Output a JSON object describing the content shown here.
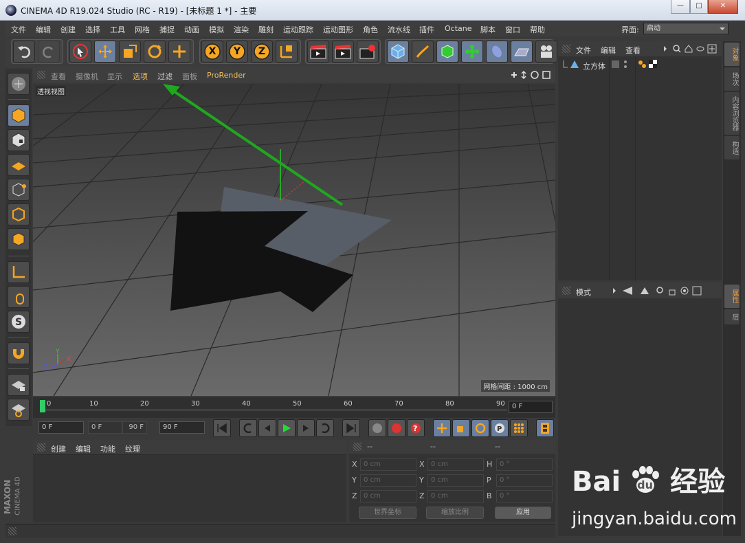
{
  "window": {
    "title": "CINEMA 4D R19.024 Studio (RC - R19) - [未标题 1 *] - 主要",
    "buttons": {
      "minimize": "—",
      "maximize": "□",
      "close": "✕"
    }
  },
  "menu": {
    "items": [
      "文件",
      "编辑",
      "创建",
      "选择",
      "工具",
      "网格",
      "捕捉",
      "动画",
      "模拟",
      "渲染",
      "雕刻",
      "运动跟踪",
      "运动图形",
      "角色",
      "流水线",
      "插件",
      "Octane",
      "脚本",
      "窗口",
      "帮助"
    ],
    "layout_label": "界面:",
    "layout_value": "启动"
  },
  "toolbar": {
    "axis_x": "X",
    "axis_y": "Y",
    "axis_z": "Z"
  },
  "viewport": {
    "menu": [
      "查看",
      "摄像机",
      "显示",
      "选项",
      "过滤",
      "面板",
      "ProRender"
    ],
    "view_name": "透视视图",
    "grid_spacing": "网格间距 : 1000 cm",
    "axis_labels": {
      "x": "X",
      "y": "Y",
      "z": "Z"
    }
  },
  "timeline": {
    "ticks": [
      "0",
      "10",
      "20",
      "30",
      "40",
      "50",
      "60",
      "70",
      "80",
      "90"
    ],
    "current_frame": "0 F"
  },
  "transport": {
    "start_field": "0 F",
    "range_start": "0 F",
    "range_end": "90 F",
    "end_field": "90 F"
  },
  "materials": {
    "menu": [
      "创建",
      "编辑",
      "功能",
      "纹理"
    ]
  },
  "coordinates": {
    "headers": [
      "--",
      "--",
      "--"
    ],
    "rows": [
      {
        "a_label": "X",
        "a_value": "0 cm",
        "b_label": "X",
        "b_value": "0 cm",
        "c_label": "H",
        "c_value": "0 °"
      },
      {
        "a_label": "Y",
        "a_value": "0 cm",
        "b_label": "Y",
        "b_value": "0 cm",
        "c_label": "P",
        "c_value": "0 °"
      },
      {
        "a_label": "Z",
        "a_value": "0 cm",
        "b_label": "Z",
        "b_value": "0 cm",
        "c_label": "B",
        "c_value": "0 °"
      }
    ],
    "world_coords": "世界坐标",
    "scale": "缩放比例",
    "apply": "应用"
  },
  "objects": {
    "menu": [
      "文件",
      "编辑",
      "查看"
    ],
    "items": [
      {
        "name": "立方体"
      }
    ]
  },
  "attributes": {
    "menu": [
      "模式"
    ]
  },
  "right_tabs": {
    "top": [
      "对象",
      "场次",
      "内容浏览器",
      "构造"
    ],
    "bottom": [
      "属性",
      "层"
    ]
  },
  "branding": {
    "maxon": "MAXON",
    "cinema": "CINEMA 4D"
  },
  "watermark": {
    "main": "Bai",
    "paw": "du",
    "cn": "经验",
    "url": "jingyan.baidu.com"
  },
  "colors": {
    "accent_orange": "#f5a623",
    "annotation_arrow": "#1fa81f",
    "highlight_blue": "#6b7f9e"
  }
}
